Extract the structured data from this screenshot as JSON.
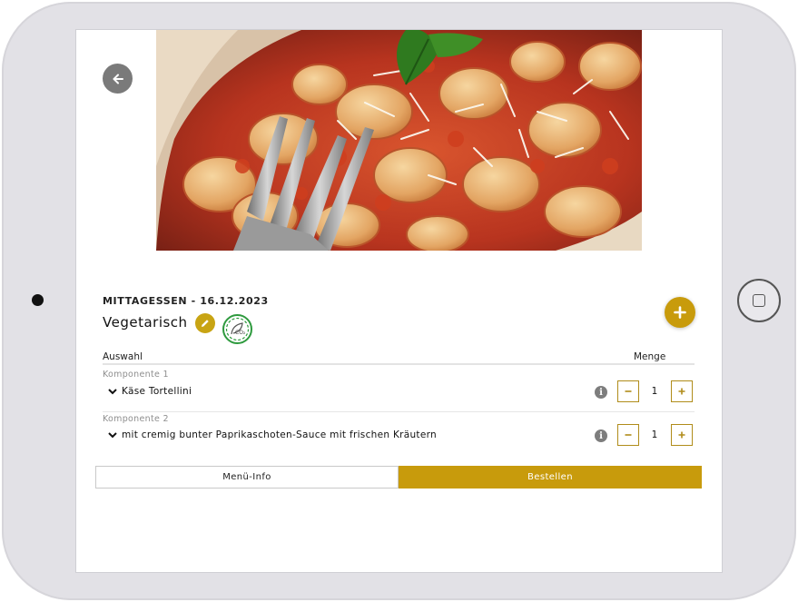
{
  "meal": {
    "category_date": "MITTAGESSEN - 16.12.2023",
    "name": "Vegetarisch"
  },
  "table": {
    "col_selection": "Auswahl",
    "col_quantity": "Menge"
  },
  "components": [
    {
      "label": "Komponente 1",
      "item": "Käse Tortellini",
      "quantity": "1"
    },
    {
      "label": "Komponente 2",
      "item": "mit cremig bunter Paprikaschoten-Sauce mit frischen Kräutern",
      "quantity": "1"
    }
  ],
  "tabs": {
    "info": "Menü-Info",
    "order": "Bestellen"
  },
  "icons": {
    "back": "arrow-left-icon",
    "edit": "pencil-icon",
    "co2": "co2-leaf-icon",
    "add": "plus-icon",
    "info": "info-icon",
    "expand": "chevron-down-icon",
    "minus": "minus-icon",
    "plus": "plus-icon"
  },
  "colors": {
    "accent": "#c89b0c",
    "back_button": "#7a7a7a",
    "co2_green": "#2e9a3e"
  }
}
